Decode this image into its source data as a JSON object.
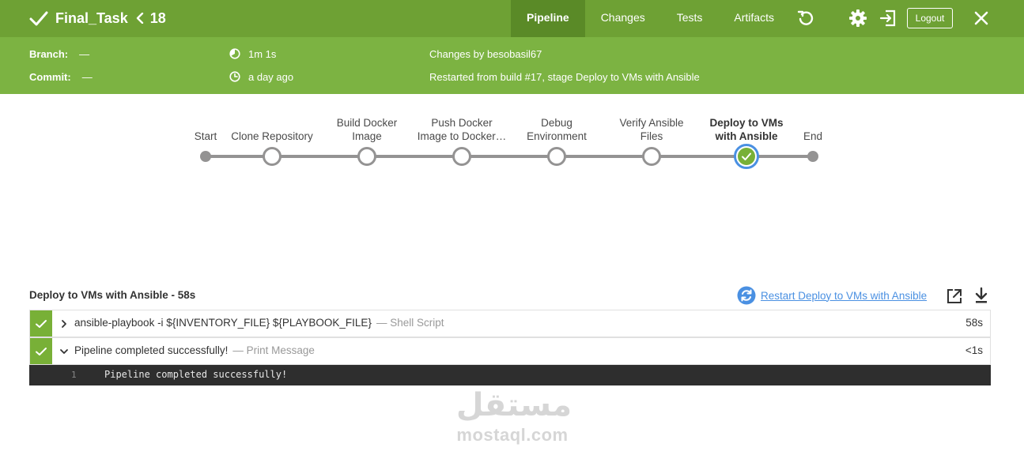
{
  "header": {
    "job_name": "Final_Task",
    "build_number": "18",
    "tabs": [
      {
        "label": "Pipeline",
        "active": true
      },
      {
        "label": "Changes",
        "active": false
      },
      {
        "label": "Tests",
        "active": false
      },
      {
        "label": "Artifacts",
        "active": false
      }
    ],
    "logout_label": "Logout",
    "colors": {
      "bar": "#6ea134",
      "active_tab": "#5a8a27",
      "info_bar": "#7cb342"
    }
  },
  "info": {
    "branch_label": "Branch:",
    "branch_value": "—",
    "commit_label": "Commit:",
    "commit_value": "—",
    "duration": "1m 1s",
    "time_ago": "a day ago",
    "changes": "Changes by besobasil67",
    "cause": "Restarted from build #17, stage Deploy to VMs with Ansible"
  },
  "pipeline": {
    "stages": [
      {
        "lines": [
          "Start"
        ],
        "kind": "start"
      },
      {
        "lines": [
          "Clone Repository"
        ],
        "kind": "stage"
      },
      {
        "lines": [
          "Build Docker",
          "Image"
        ],
        "kind": "stage"
      },
      {
        "lines": [
          "Push Docker",
          "Image to Docker…"
        ],
        "kind": "stage"
      },
      {
        "lines": [
          "Debug",
          "Environment"
        ],
        "kind": "stage"
      },
      {
        "lines": [
          "Verify Ansible",
          "Files"
        ],
        "kind": "stage"
      },
      {
        "lines": [
          "Deploy to VMs",
          "with Ansible"
        ],
        "kind": "success",
        "selected": true
      },
      {
        "lines": [
          "End"
        ],
        "kind": "end"
      }
    ],
    "colors": {
      "line": "#949393",
      "success": "#78b037",
      "selected_ring": "#4a90e2"
    }
  },
  "step_detail": {
    "title": "Deploy to VMs with Ansible - 58s",
    "restart_label": "Restart Deploy to VMs with Ansible",
    "steps": [
      {
        "command": "ansible-playbook -i ${INVENTORY_FILE} ${PLAYBOOK_FILE}",
        "type": "— Shell Script",
        "duration": "58s",
        "expanded": false
      },
      {
        "command": "Pipeline completed successfully!",
        "type": "— Print Message",
        "duration": "<1s",
        "expanded": true
      }
    ],
    "log": [
      {
        "line": "1",
        "text": "Pipeline completed successfully!"
      }
    ]
  },
  "watermark": {
    "arabic": "مستقل",
    "latin": "mostaql.com"
  }
}
